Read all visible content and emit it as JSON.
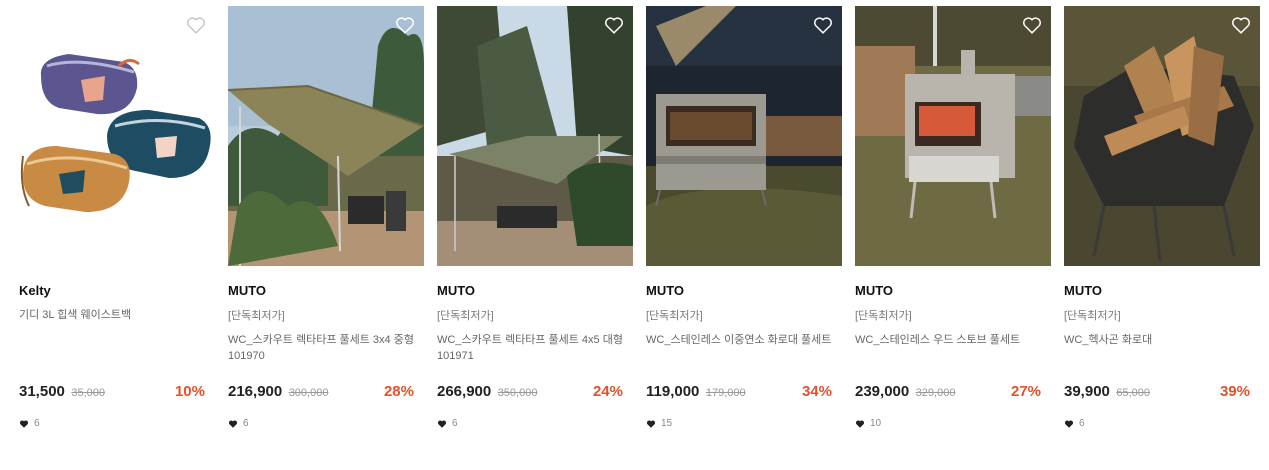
{
  "products": [
    {
      "brand": "Kelty",
      "tag": "",
      "name": "기디 3L 힙색 웨이스트백",
      "price": "31,500",
      "original_price": "35,000",
      "discount": "10%",
      "likes": "6"
    },
    {
      "brand": "MUTO",
      "tag": "[단독최저가]",
      "name": "WC_스카우트 렉타타프 풀세트 3x4 중형 101970",
      "price": "216,900",
      "original_price": "300,000",
      "discount": "28%",
      "likes": "6"
    },
    {
      "brand": "MUTO",
      "tag": "[단독최저가]",
      "name": "WC_스카우트 렉타타프 풀세트 4x5 대형 101971",
      "price": "266,900",
      "original_price": "350,000",
      "discount": "24%",
      "likes": "6"
    },
    {
      "brand": "MUTO",
      "tag": "[단독최저가]",
      "name": "WC_스테인레스 이중연소 화로대 풀세트",
      "price": "119,000",
      "original_price": "179,000",
      "discount": "34%",
      "likes": "15"
    },
    {
      "brand": "MUTO",
      "tag": "[단독최저가]",
      "name": "WC_스테인레스 우드 스토브 풀세트",
      "price": "239,000",
      "original_price": "329,000",
      "discount": "27%",
      "likes": "10"
    },
    {
      "brand": "MUTO",
      "tag": "[단독최저가]",
      "name": "WC_헥사곤 화로대",
      "price": "39,900",
      "original_price": "65,000",
      "discount": "39%",
      "likes": "6"
    }
  ],
  "colors": {
    "discount": "#e5502b",
    "brand_text": "#111111",
    "muted": "#777777"
  },
  "icons": {
    "wishlist": "heart-outline-icon",
    "likes": "heart-filled-icon"
  }
}
